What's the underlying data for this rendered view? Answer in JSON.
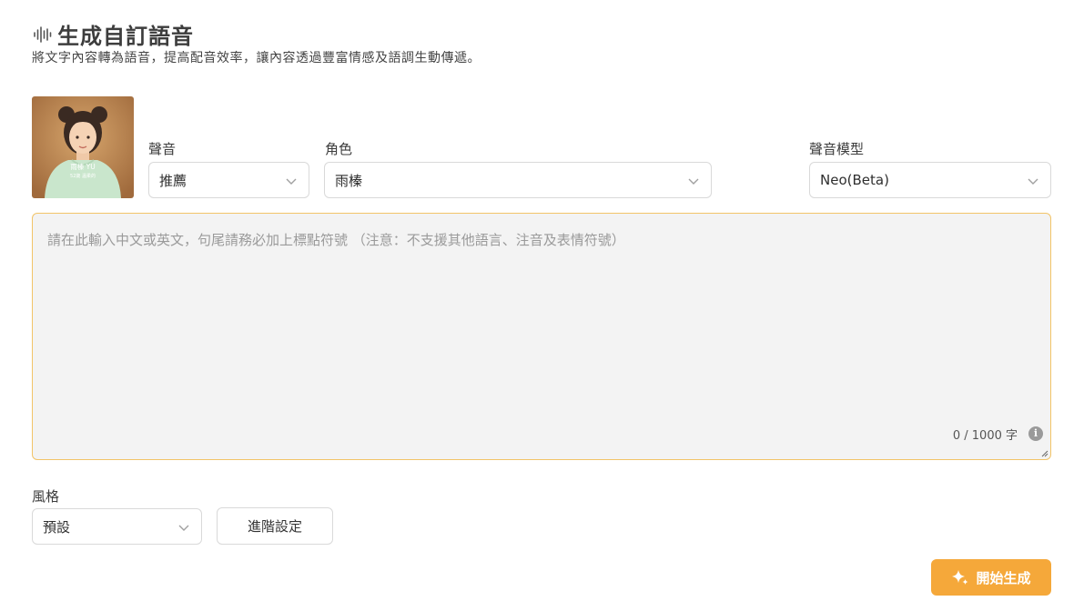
{
  "header": {
    "icon": "waveform-icon",
    "title": "生成自訂語音",
    "subtitle": "將文字內容轉為語音，提高配音效率，讓內容透過豐富情感及語調生動傳遞。"
  },
  "avatar": {
    "name_text": "雨榛 YU",
    "sub_text": "52歲 溫柔的"
  },
  "voice": {
    "label": "聲音",
    "value": "推薦"
  },
  "character": {
    "label": "角色",
    "value": "雨榛"
  },
  "model": {
    "label": "聲音模型",
    "value": "Neo(Beta)"
  },
  "editor": {
    "placeholder": "請在此輸入中文或英文，句尾請務必加上標點符號 （注意：不支援其他語言、注音及表情符號）",
    "value": "",
    "counter": "0 / 1000 字"
  },
  "style": {
    "label": "風格",
    "value": "預設"
  },
  "buttons": {
    "advanced": "進階設定",
    "generate": "開始生成"
  },
  "colors": {
    "accent": "#f5a83a",
    "editor_border": "#f2c468",
    "editor_bg": "#f3f3f3"
  }
}
